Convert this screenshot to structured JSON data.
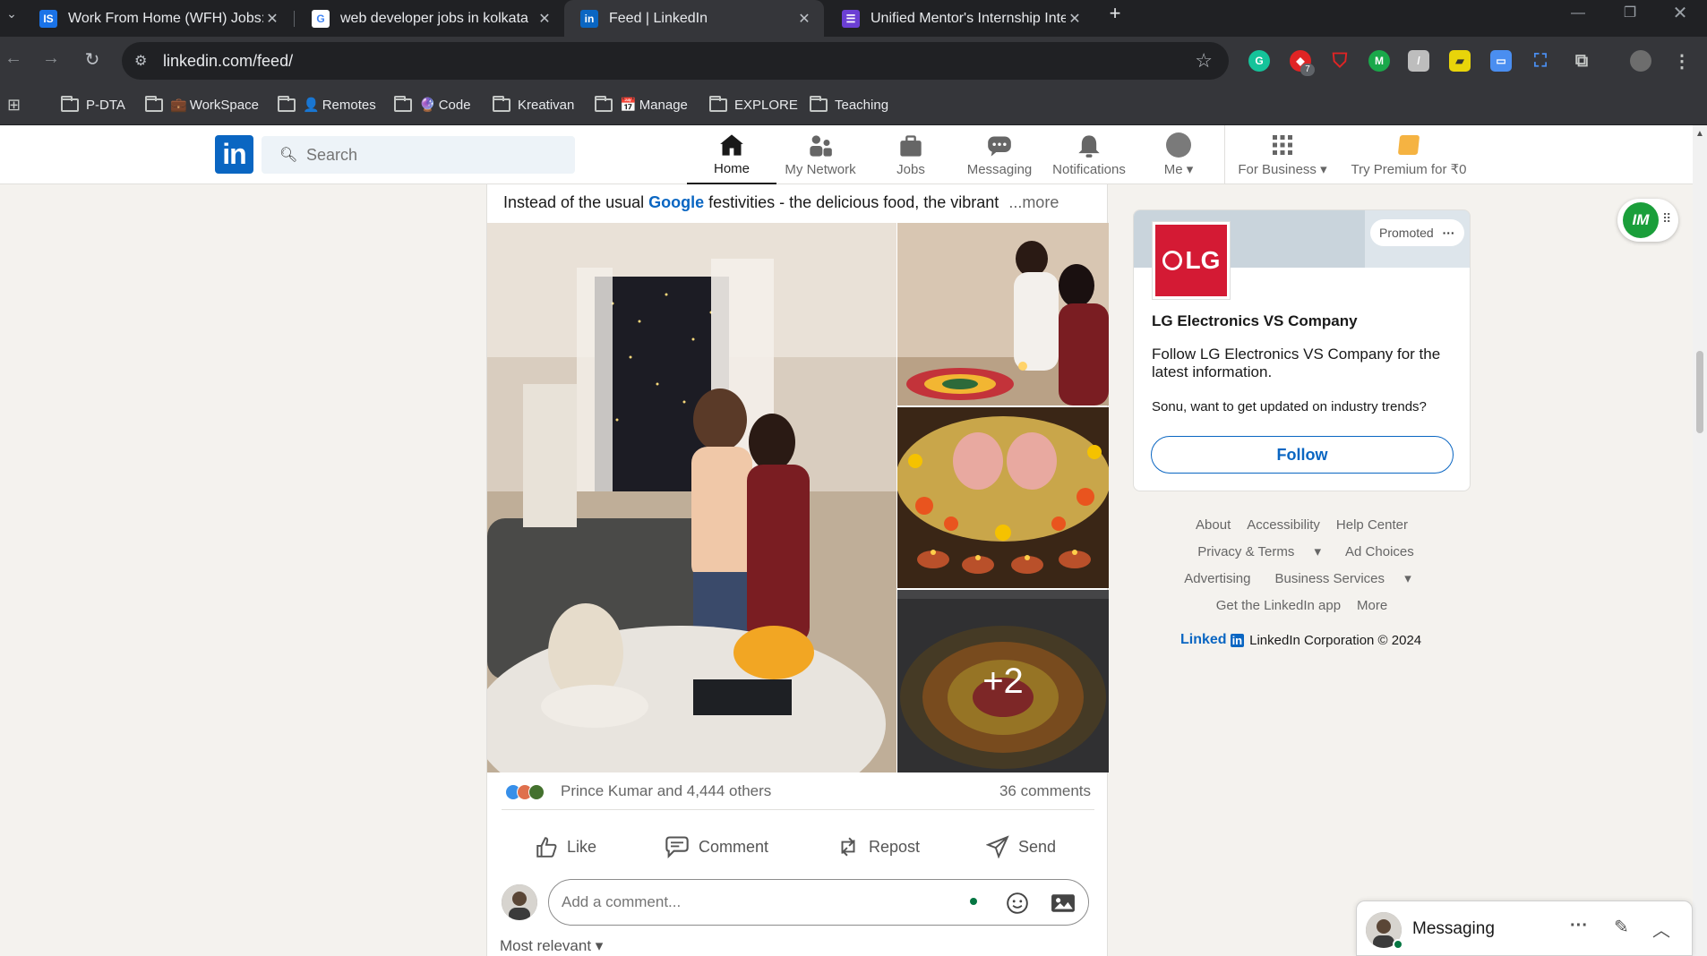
{
  "browser": {
    "tabs": [
      {
        "title": "Work From Home (WFH) Jobs: I",
        "favicon": "IS"
      },
      {
        "title": "web developer jobs in kolkata",
        "favicon": "G"
      },
      {
        "title": "Feed | LinkedIn",
        "favicon": "in"
      },
      {
        "title": "Unified Mentor's Internship Inte",
        "favicon": "☰"
      }
    ],
    "url": "linkedin.com/feed/",
    "extension_badge": "7",
    "bookmarks": [
      "P-DTA",
      "WorkSpace",
      "Remotes",
      "Code",
      "Kreativan",
      "Manage",
      "EXPLORE",
      "Teaching"
    ]
  },
  "linkedin": {
    "search_placeholder": "Search",
    "nav": [
      "Home",
      "My Network",
      "Jobs",
      "Messaging",
      "Notifications",
      "Me",
      "For Business",
      "Try Premium for ₹0"
    ]
  },
  "post": {
    "text_before": "Instead of the usual ",
    "text_link": "Google",
    "text_after": " festivities - the delicious food, the vibrant",
    "more": "...more",
    "extra_photos": "+2",
    "reactions_text": "Prince Kumar and 4,444 others",
    "comments_count": "36 comments",
    "actions": {
      "like": "Like",
      "comment": "Comment",
      "repost": "Repost",
      "send": "Send"
    },
    "comment_placeholder": "Add a comment...",
    "sort": "Most relevant"
  },
  "ad": {
    "promoted": "Promoted",
    "logo_text": "LG",
    "company": "LG Electronics VS Company",
    "description": "Follow LG Electronics VS Company for the latest information.",
    "question": "Sonu, want to get updated on industry trends?",
    "follow": "Follow"
  },
  "footer": {
    "row1": [
      "About",
      "Accessibility",
      "Help Center"
    ],
    "row2": [
      "Privacy & Terms",
      "Ad Choices"
    ],
    "row3": [
      "Advertising",
      "Business Services"
    ],
    "row4": [
      "Get the LinkedIn app",
      "More"
    ],
    "brand": "Linked",
    "brand_in": "in",
    "copyright": "LinkedIn Corporation © 2024"
  },
  "floating_ext_label": "IM",
  "messaging": {
    "label": "Messaging"
  },
  "colors": {
    "linkedin_blue": "#0a66c2",
    "lg_red": "#d41a34",
    "online_green": "#057642"
  }
}
